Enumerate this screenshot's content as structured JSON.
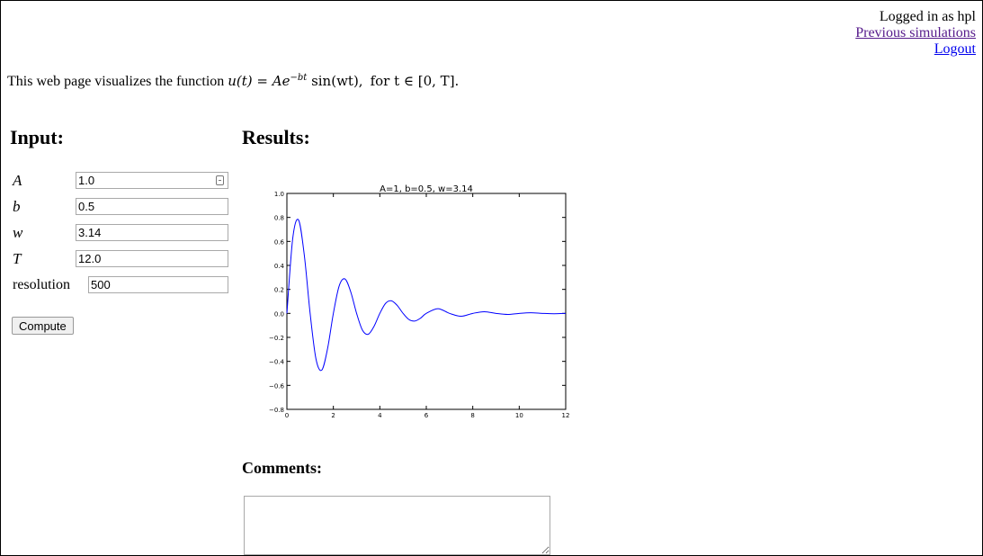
{
  "header": {
    "logged_in_text": "Logged in as hpl",
    "previous_simulations_link": "Previous simulations",
    "logout_link": "Logout"
  },
  "intro": {
    "prefix": "This web page visualizes the function ",
    "formula": "u(t) = Ae",
    "exponent": "−bt",
    "formula_tail": " sin(wt),",
    "range_text": "for t ∈ [0, T]."
  },
  "input_section": {
    "heading": "Input:",
    "fields": [
      {
        "label": "A",
        "value": "1.0"
      },
      {
        "label": "b",
        "value": "0.5"
      },
      {
        "label": "w",
        "value": "3.14"
      },
      {
        "label": "T",
        "value": "12.0"
      },
      {
        "label": "resolution",
        "value": "500"
      }
    ],
    "compute_button": "Compute"
  },
  "results_section": {
    "heading": "Results:"
  },
  "comments_section": {
    "heading": "Comments:",
    "value": ""
  },
  "chart_data": {
    "type": "line",
    "title": "A=1, b=0.5, w=3.14",
    "xlabel": "",
    "ylabel": "",
    "xlim": [
      0,
      12
    ],
    "ylim": [
      -0.8,
      1.0
    ],
    "xticks": [
      "0",
      "2",
      "4",
      "6",
      "8",
      "10",
      "12"
    ],
    "yticks": [
      "1.0",
      "0.8",
      "0.6",
      "0.4",
      "0.2",
      "0.0",
      "−0.2",
      "−0.4",
      "−0.6",
      "−0.8"
    ],
    "series": [
      {
        "color": "#0000ff",
        "x": [
          0,
          0.25,
          0.5,
          0.75,
          1,
          1.25,
          1.5,
          1.75,
          2,
          2.25,
          2.5,
          2.75,
          3,
          3.25,
          3.5,
          3.75,
          4,
          4.25,
          4.5,
          4.75,
          5,
          5.25,
          5.5,
          5.75,
          6,
          6.5,
          7,
          7.5,
          8,
          8.5,
          9,
          9.5,
          10,
          10.5,
          11,
          11.5,
          12
        ],
        "y": [
          0,
          0.623,
          0.779,
          0.484,
          0.0,
          -0.378,
          -0.473,
          -0.294,
          0.0,
          0.229,
          0.287,
          0.178,
          0.0,
          -0.139,
          -0.174,
          -0.108,
          0.0,
          0.084,
          0.105,
          0.066,
          0.0,
          -0.051,
          -0.064,
          -0.04,
          0.0,
          0.039,
          0.0,
          -0.024,
          0.0,
          0.014,
          0.0,
          -0.009,
          0.0,
          0.005,
          0.0,
          -0.003,
          0.0
        ]
      }
    ]
  }
}
